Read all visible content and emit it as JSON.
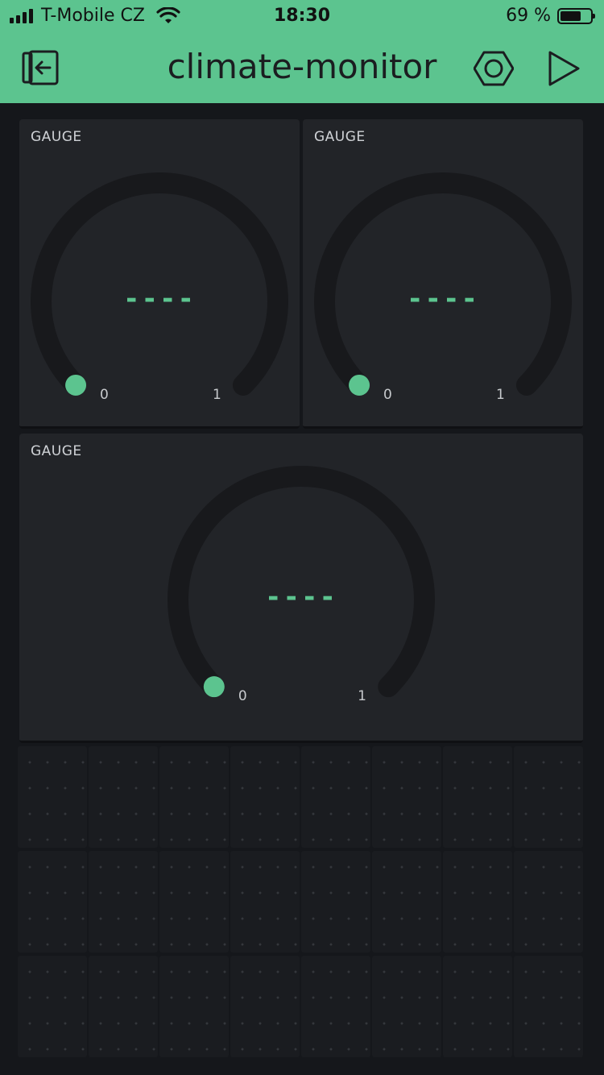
{
  "status_bar": {
    "carrier": "T-Mobile CZ",
    "time": "18:30",
    "battery": "69 %"
  },
  "header": {
    "title": "climate-monitor",
    "back_icon": "exit-app-icon",
    "settings_icon": "hexagon-settings-icon",
    "play_icon": "play-icon"
  },
  "colors": {
    "accent": "#5cc48f",
    "background": "#15171b",
    "widget": "#222428",
    "arc": "#18191c"
  },
  "widgets": [
    {
      "label": "GAUGE",
      "value": "----",
      "min": "0",
      "max": "1",
      "level": 0
    },
    {
      "label": "GAUGE",
      "value": "----",
      "min": "0",
      "max": "1",
      "level": 0
    },
    {
      "label": "GAUGE",
      "value": "----",
      "min": "0",
      "max": "1",
      "level": 0
    }
  ]
}
